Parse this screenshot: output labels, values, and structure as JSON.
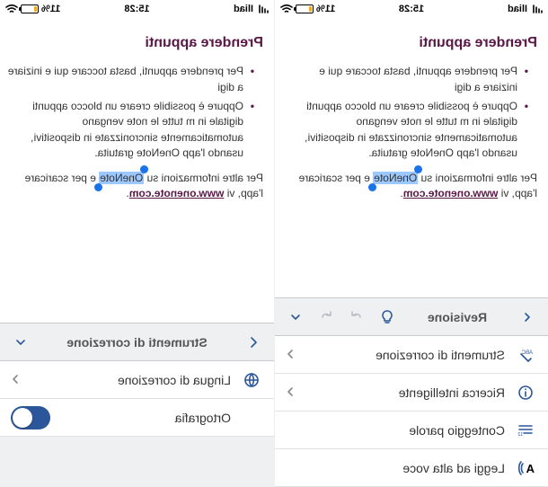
{
  "status": {
    "carrier": "Iliad",
    "time": "15:28",
    "battery_pct": "11%"
  },
  "doc": {
    "heading": "Prendere appunti",
    "bullets": [
      "Per prendere appunti, basta toccare qui e iniziare a digi",
      "Oppure è possibile creare un blocco appunti digitale in m tutte le note vengano automaticamente sincronizzate in dispositivi, usando l'app OneNote gratuita."
    ],
    "para_pre": "Per altre informazioni su ",
    "selected": "OneNote",
    "para_post": " e per scaricare l'app, vi ",
    "link": "www.onenote.com"
  },
  "right": {
    "tab": "Revisione",
    "items": [
      "Strumenti di correzione",
      "Ricerca intelligente",
      "Conteggio parole",
      "Leggi ad alta voce"
    ]
  },
  "left": {
    "title": "Strumenti di correzione",
    "items": [
      "Lingua di correzione",
      "Ortografia"
    ],
    "spelling_on": true
  }
}
